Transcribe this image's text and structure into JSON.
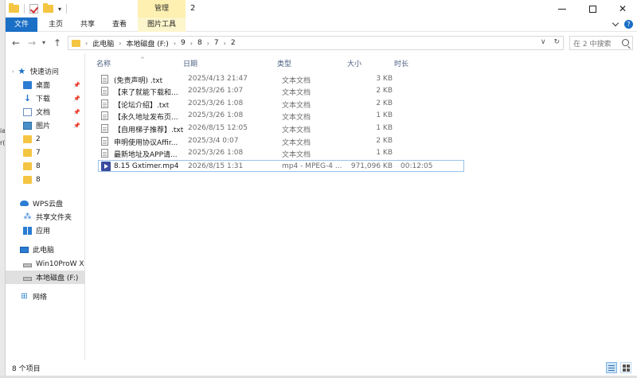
{
  "window": {
    "title": "2",
    "manage_tab": "管理",
    "close_glyph": "✕"
  },
  "ribbon": {
    "tabs": [
      "文件",
      "主页",
      "共享",
      "查看",
      "图片工具"
    ]
  },
  "address": {
    "crumbs": [
      "此电脑",
      "本地磁盘 (F:)",
      "9",
      "8",
      "7",
      "2"
    ],
    "search_placeholder": "在 2 中搜索"
  },
  "nav": {
    "quick_access": "快速访问",
    "items": [
      {
        "label": "桌面",
        "icon": "desktop-icon",
        "pinned": true
      },
      {
        "label": "下载",
        "icon": "download-icon",
        "pinned": true
      },
      {
        "label": "文档",
        "icon": "document-icon",
        "pinned": true
      },
      {
        "label": "图片",
        "icon": "picture-icon",
        "pinned": true
      },
      {
        "label": "2",
        "icon": "folder-icon"
      },
      {
        "label": "7",
        "icon": "folder-icon"
      },
      {
        "label": "8",
        "icon": "folder-icon"
      },
      {
        "label": "8",
        "icon": "folder-icon"
      }
    ],
    "wps_cloud": "WPS云盘",
    "shared_folder": "共享文件夹",
    "apps": "应用",
    "this_pc": "此电脑",
    "drives": [
      "Win10ProW X",
      "本地磁盘 (F:)"
    ],
    "network": "网络"
  },
  "columns": {
    "name": "名称",
    "date": "日期",
    "type": "类型",
    "size": "大小",
    "duration": "时长"
  },
  "files": [
    {
      "name": "(免责声明) .txt",
      "date": "2025/4/13 21:47",
      "type": "文本文档",
      "size": "3 KB",
      "duration": ""
    },
    {
      "name": "【来了就能下载和...",
      "date": "2025/3/26 1:07",
      "type": "文本文档",
      "size": "2 KB",
      "duration": ""
    },
    {
      "name": "【论坛介绍】.txt",
      "date": "2025/3/26 1:08",
      "type": "文本文档",
      "size": "2 KB",
      "duration": ""
    },
    {
      "name": "【永久地址发布页...",
      "date": "2025/3/26 1:08",
      "type": "文本文档",
      "size": "1 KB",
      "duration": ""
    },
    {
      "name": "【自用梯子推荐】.txt",
      "date": "2026/8/15 12:05",
      "type": "文本文档",
      "size": "1 KB",
      "duration": ""
    },
    {
      "name": "申明使用协议Affir...",
      "date": "2025/3/4 0:07",
      "type": "文本文档",
      "size": "2 KB",
      "duration": ""
    },
    {
      "name": "最新地址及APP请...",
      "date": "2025/3/26 1:08",
      "type": "文本文档",
      "size": "1 KB",
      "duration": ""
    },
    {
      "name": "8.15 Gxtimer.mp4",
      "date": "2026/8/15 1:31",
      "type": "mp4 - MPEG-4 ...",
      "size": "971,096 KB",
      "duration": "00:12:05",
      "video": true
    }
  ],
  "status": {
    "count": "8 个项目"
  }
}
